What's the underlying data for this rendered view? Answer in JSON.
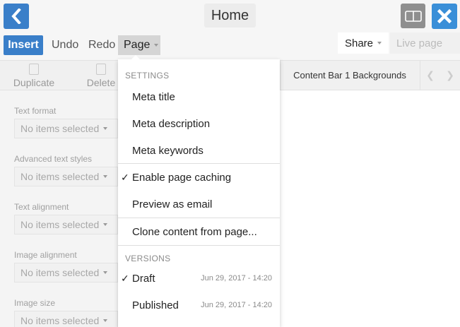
{
  "header": {
    "title": "Home"
  },
  "toolbar": {
    "insert": "Insert",
    "undo": "Undo",
    "redo": "Redo",
    "page": "Page",
    "share": "Share",
    "live_page": "Live page"
  },
  "subbar": {
    "duplicate": "Duplicate",
    "delete": "Delete",
    "content_label": "Content Bar 1 Backgrounds"
  },
  "left_panel": {
    "fields": [
      {
        "label": "Text format",
        "value": "No items selected"
      },
      {
        "label": "Advanced text styles",
        "value": "No items selected"
      },
      {
        "label": "Text alignment",
        "value": "No items selected"
      },
      {
        "label": "Image alignment",
        "value": "No items selected"
      },
      {
        "label": "Image size",
        "value": "No items selected"
      }
    ]
  },
  "page_menu": {
    "settings_header": "SETTINGS",
    "meta_title": "Meta title",
    "meta_description": "Meta description",
    "meta_keywords": "Meta keywords",
    "enable_page_caching": "Enable page caching",
    "enable_page_caching_checked": true,
    "preview_as_email": "Preview as email",
    "clone_content": "Clone content from page...",
    "versions_header": "VERSIONS",
    "versions": [
      {
        "name": "Draft",
        "date": "Jun 29, 2017 - 14:20",
        "checked": true
      },
      {
        "name": "Published",
        "date": "Jun 29, 2017 - 14:20",
        "checked": false
      }
    ]
  },
  "colors": {
    "primary_blue": "#3a7fc9",
    "close_blue": "#3a8fd8"
  }
}
